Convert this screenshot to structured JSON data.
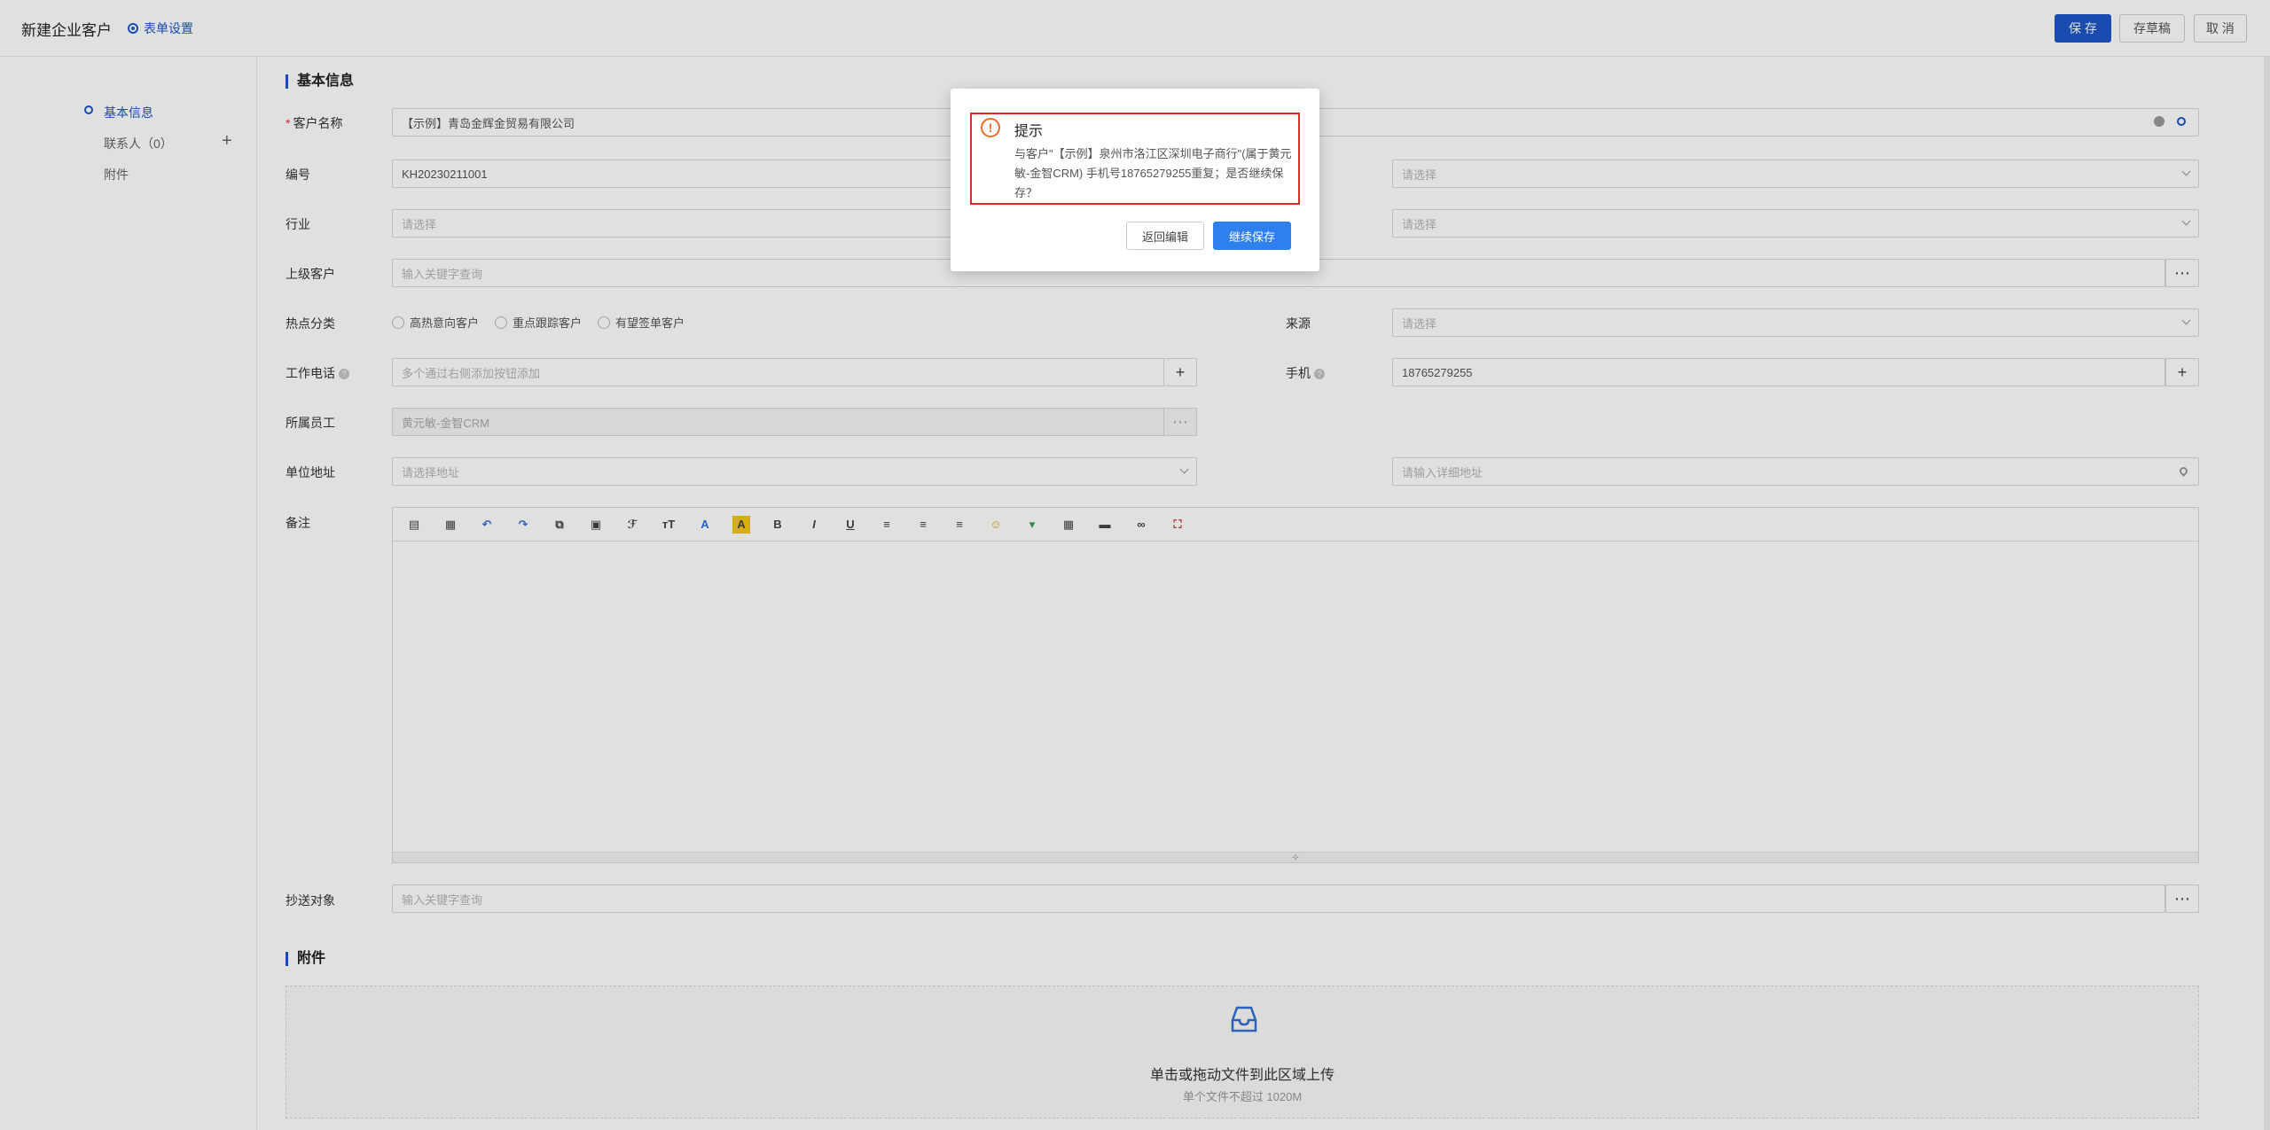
{
  "header": {
    "title": "新建企业客户",
    "settings_label": "表单设置",
    "save_label": "保 存",
    "draft_label": "存草稿",
    "cancel_label": "取 消",
    "accent_color": "#1d56c9"
  },
  "nav": {
    "items": [
      {
        "label": "基本信息"
      },
      {
        "label": "联系人（0）"
      },
      {
        "label": "附件"
      }
    ]
  },
  "form": {
    "section_basic": "基本信息",
    "customer_name_label": "客户名称",
    "customer_name_value": "【示例】青岛金辉金贸易有限公司",
    "code_label": "编号",
    "code_value": "KH20230211001",
    "code_right_placeholder": "请选择",
    "industry_label": "行业",
    "industry_placeholder": "请选择",
    "industry_right_placeholder": "请选择",
    "parent_label": "上级客户",
    "parent_placeholder": "输入关键字查询",
    "hot_label": "热点分类",
    "hot_options": [
      "高热意向客户",
      "重点跟踪客户",
      "有望签单客户"
    ],
    "source_label": "来源",
    "source_placeholder": "请选择",
    "phone_label": "工作电话",
    "phone_placeholder": "多个通过右侧添加按钮添加",
    "mobile_label": "手机",
    "mobile_value": "18765279255",
    "owner_label": "所属员工",
    "owner_value": "黄元敏-金智CRM",
    "address_label": "单位地址",
    "address_placeholder": "请选择地址",
    "address_detail_placeholder": "请输入详细地址",
    "remark_label": "备注",
    "cc_label": "抄送对象",
    "cc_placeholder": "输入关键字查询",
    "section_attach": "附件",
    "upload_title": "单击或拖动文件到此区域上传",
    "upload_hint": "单个文件不超过 1020M"
  },
  "modal": {
    "title": "提示",
    "message": "与客户\"【示例】泉州市洛江区深圳电子商行\"(属于黄元敏-金智CRM) 手机号18765279255重复；是否继续保存？",
    "back_label": "返回编辑",
    "continue_label": "继续保存",
    "highlight_color": "#e02a2a"
  }
}
